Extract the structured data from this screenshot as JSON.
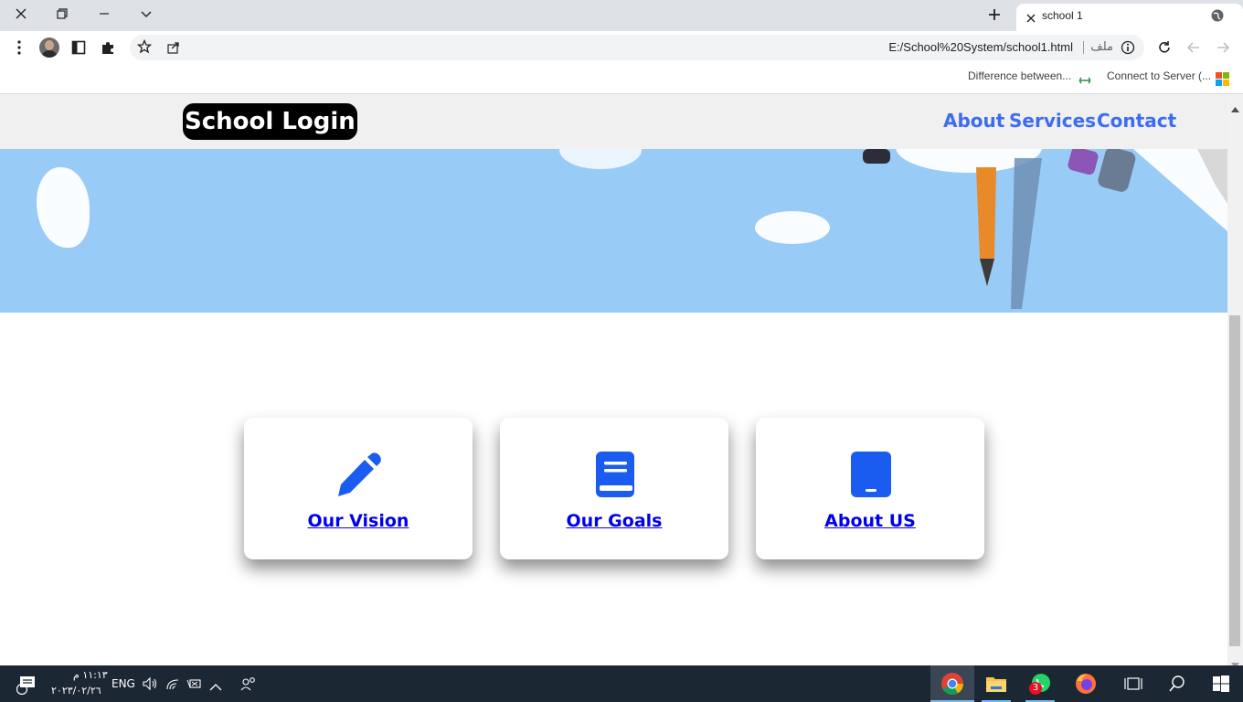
{
  "browser": {
    "tab_title": "school 1",
    "url": "E:/School%20System/school1.html",
    "file_label": "ملف",
    "bookmarks": [
      "Difference between...",
      "Connect to Server (..."
    ]
  },
  "page": {
    "brand": "School Login",
    "nav": [
      "About",
      "Services",
      "Contact"
    ],
    "cards": [
      {
        "label": "Our Vision",
        "icon": "pencil-icon"
      },
      {
        "label": "Our Goals",
        "icon": "book-icon"
      },
      {
        "label": "About US",
        "icon": "tablet-icon"
      }
    ],
    "colors": {
      "nav_link": "#3b6cf2",
      "card_link": "#0000ee",
      "icon": "#1a5cf0",
      "hero_sky": "#99cbf7"
    }
  },
  "taskbar": {
    "time": "١١:١٣ م",
    "date": "٢٠٢٣/٠٢/٢٦",
    "language": "ENG",
    "notification_count": "3"
  }
}
